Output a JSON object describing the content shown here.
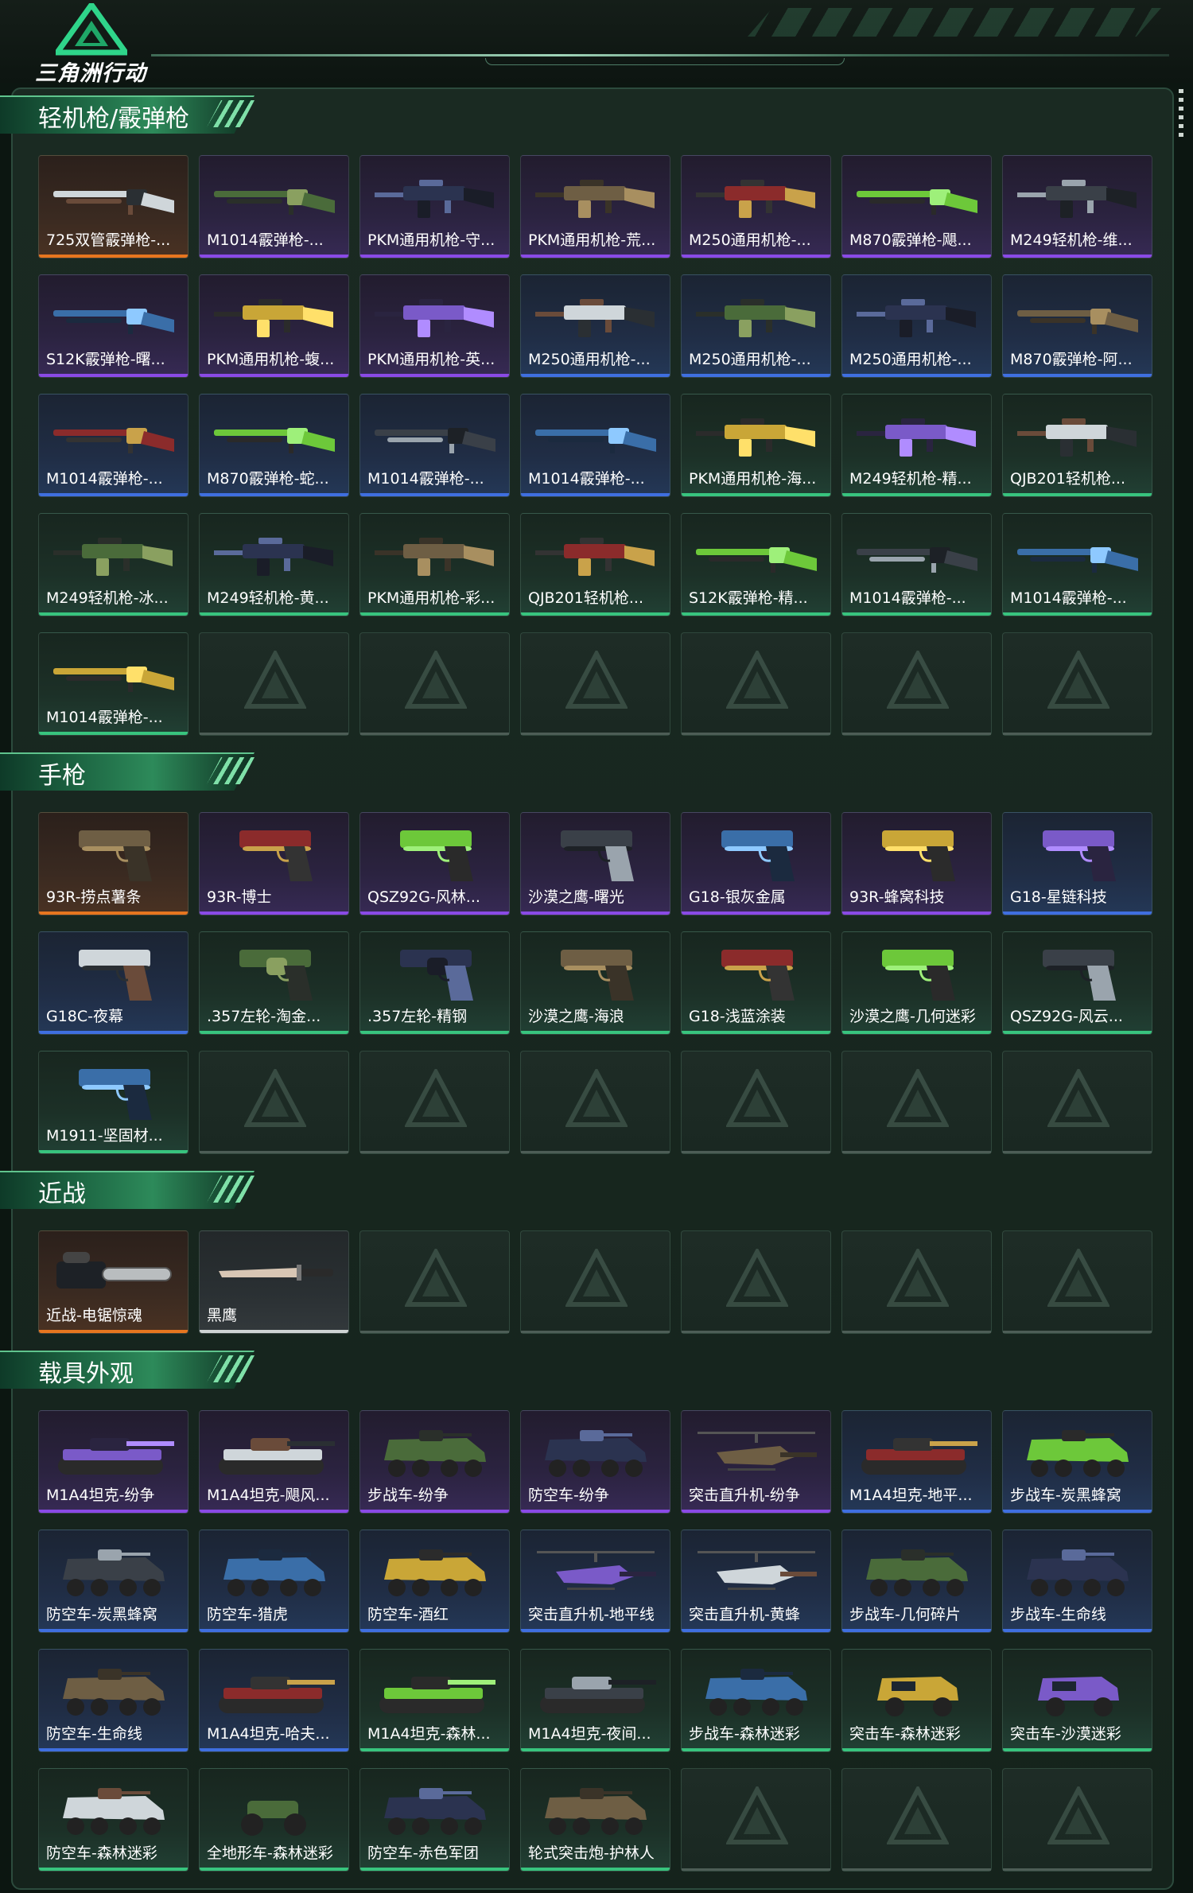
{
  "header": {
    "logo_text": "三角洲行动"
  },
  "colors": {
    "orange": "#e7761f",
    "purple": "#8a4ae6",
    "blue": "#3f6fe0",
    "green": "#38c47e",
    "white": "#cfd4d4"
  },
  "sections": [
    {
      "title": "轻机枪/霰弹枪",
      "slots": 35,
      "items": [
        {
          "name": "725双管霰弹枪-...",
          "rarity": "orange",
          "icon": "shotgun-icon"
        },
        {
          "name": "M1014霰弹枪-...",
          "rarity": "purple",
          "icon": "shotgun-icon"
        },
        {
          "name": "PKM通用机枪-守...",
          "rarity": "purple",
          "icon": "machinegun-icon"
        },
        {
          "name": "PKM通用机枪-荒...",
          "rarity": "purple",
          "icon": "machinegun-icon"
        },
        {
          "name": "M250通用机枪-...",
          "rarity": "purple",
          "icon": "machinegun-icon"
        },
        {
          "name": "M870霰弹枪-飓...",
          "rarity": "purple",
          "icon": "shotgun-icon"
        },
        {
          "name": "M249轻机枪-维...",
          "rarity": "purple",
          "icon": "machinegun-icon"
        },
        {
          "name": "S12K霰弹枪-曙...",
          "rarity": "purple",
          "icon": "shotgun-icon"
        },
        {
          "name": "PKM通用机枪-蝮...",
          "rarity": "purple",
          "icon": "machinegun-icon"
        },
        {
          "name": "PKM通用机枪-英...",
          "rarity": "purple",
          "icon": "machinegun-icon"
        },
        {
          "name": "M250通用机枪-...",
          "rarity": "blue",
          "icon": "machinegun-icon"
        },
        {
          "name": "M250通用机枪-...",
          "rarity": "blue",
          "icon": "machinegun-icon"
        },
        {
          "name": "M250通用机枪-...",
          "rarity": "blue",
          "icon": "machinegun-icon"
        },
        {
          "name": "M870霰弹枪-阿...",
          "rarity": "blue",
          "icon": "shotgun-icon"
        },
        {
          "name": "M1014霰弹枪-...",
          "rarity": "blue",
          "icon": "shotgun-icon"
        },
        {
          "name": "M870霰弹枪-蛇...",
          "rarity": "blue",
          "icon": "shotgun-icon"
        },
        {
          "name": "M1014霰弹枪-...",
          "rarity": "blue",
          "icon": "shotgun-icon"
        },
        {
          "name": "M1014霰弹枪-...",
          "rarity": "blue",
          "icon": "shotgun-icon"
        },
        {
          "name": "PKM通用机枪-海...",
          "rarity": "green",
          "icon": "machinegun-icon"
        },
        {
          "name": "M249轻机枪-精...",
          "rarity": "green",
          "icon": "machinegun-icon"
        },
        {
          "name": "QJB201轻机枪...",
          "rarity": "green",
          "icon": "machinegun-icon"
        },
        {
          "name": "M249轻机枪-冰...",
          "rarity": "green",
          "icon": "machinegun-icon"
        },
        {
          "name": "M249轻机枪-黄...",
          "rarity": "green",
          "icon": "machinegun-icon"
        },
        {
          "name": "PKM通用机枪-彩...",
          "rarity": "green",
          "icon": "machinegun-icon"
        },
        {
          "name": "QJB201轻机枪...",
          "rarity": "green",
          "icon": "machinegun-icon"
        },
        {
          "name": "S12K霰弹枪-精...",
          "rarity": "green",
          "icon": "shotgun-icon"
        },
        {
          "name": "M1014霰弹枪-...",
          "rarity": "green",
          "icon": "shotgun-icon"
        },
        {
          "name": "M1014霰弹枪-...",
          "rarity": "green",
          "icon": "shotgun-icon"
        },
        {
          "name": "M1014霰弹枪-...",
          "rarity": "green",
          "icon": "shotgun-icon"
        }
      ]
    },
    {
      "title": "手枪",
      "slots": 21,
      "items": [
        {
          "name": "93R-捞点薯条",
          "rarity": "orange",
          "icon": "pistol-icon"
        },
        {
          "name": "93R-博士",
          "rarity": "purple",
          "icon": "pistol-icon"
        },
        {
          "name": "QSZ92G-风林...",
          "rarity": "purple",
          "icon": "pistol-icon"
        },
        {
          "name": "沙漠之鹰-曙光",
          "rarity": "purple",
          "icon": "pistol-icon"
        },
        {
          "name": "G18-银灰金属",
          "rarity": "purple",
          "icon": "pistol-icon"
        },
        {
          "name": "93R-蜂窝科技",
          "rarity": "purple",
          "icon": "pistol-icon"
        },
        {
          "name": "G18-星链科技",
          "rarity": "blue",
          "icon": "pistol-icon"
        },
        {
          "name": "G18C-夜幕",
          "rarity": "blue",
          "icon": "pistol-icon"
        },
        {
          "name": ".357左轮-淘金...",
          "rarity": "green",
          "icon": "revolver-icon"
        },
        {
          "name": ".357左轮-精钢",
          "rarity": "green",
          "icon": "revolver-icon"
        },
        {
          "name": "沙漠之鹰-海浪",
          "rarity": "green",
          "icon": "pistol-icon"
        },
        {
          "name": "G18-浅蓝涂装",
          "rarity": "green",
          "icon": "pistol-icon"
        },
        {
          "name": "沙漠之鹰-几何迷彩",
          "rarity": "green",
          "icon": "pistol-icon"
        },
        {
          "name": "QSZ92G-风云...",
          "rarity": "green",
          "icon": "pistol-icon"
        },
        {
          "name": "M1911-坚固材...",
          "rarity": "green",
          "icon": "pistol-icon"
        }
      ]
    },
    {
      "title": "近战",
      "slots": 7,
      "items": [
        {
          "name": "近战-电锯惊魂",
          "rarity": "orange",
          "icon": "chainsaw-icon"
        },
        {
          "name": "黑鹰",
          "rarity": "white",
          "icon": "knife-icon"
        }
      ]
    },
    {
      "title": "载具外观",
      "slots": 28,
      "items": [
        {
          "name": "M1A4坦克-纷争",
          "rarity": "purple",
          "icon": "tank-icon"
        },
        {
          "name": "M1A4坦克-飓风...",
          "rarity": "purple",
          "icon": "tank-icon"
        },
        {
          "name": "步战车-纷争",
          "rarity": "purple",
          "icon": "apc-icon"
        },
        {
          "name": "防空车-纷争",
          "rarity": "purple",
          "icon": "apc-icon"
        },
        {
          "name": "突击直升机-纷争",
          "rarity": "purple",
          "icon": "helicopter-icon"
        },
        {
          "name": "M1A4坦克-地平...",
          "rarity": "blue",
          "icon": "tank-icon"
        },
        {
          "name": "步战车-炭黑蜂窝",
          "rarity": "blue",
          "icon": "apc-icon"
        },
        {
          "name": "防空车-炭黑蜂窝",
          "rarity": "blue",
          "icon": "apc-icon"
        },
        {
          "name": "防空车-猎虎",
          "rarity": "blue",
          "icon": "apc-icon"
        },
        {
          "name": "防空车-酒红",
          "rarity": "blue",
          "icon": "apc-icon"
        },
        {
          "name": "突击直升机-地平线",
          "rarity": "blue",
          "icon": "helicopter-icon"
        },
        {
          "name": "突击直升机-黄蜂",
          "rarity": "blue",
          "icon": "helicopter-icon"
        },
        {
          "name": "步战车-几何碎片",
          "rarity": "blue",
          "icon": "apc-icon"
        },
        {
          "name": "步战车-生命线",
          "rarity": "blue",
          "icon": "apc-icon"
        },
        {
          "name": "防空车-生命线",
          "rarity": "blue",
          "icon": "apc-icon"
        },
        {
          "name": "M1A4坦克-哈夫...",
          "rarity": "blue",
          "icon": "tank-icon"
        },
        {
          "name": "M1A4坦克-森林...",
          "rarity": "green",
          "icon": "tank-icon"
        },
        {
          "name": "M1A4坦克-夜间...",
          "rarity": "green",
          "icon": "tank-icon"
        },
        {
          "name": "步战车-森林迷彩",
          "rarity": "green",
          "icon": "apc-icon"
        },
        {
          "name": "突击车-森林迷彩",
          "rarity": "green",
          "icon": "jeep-icon"
        },
        {
          "name": "突击车-沙漠迷彩",
          "rarity": "green",
          "icon": "jeep-icon"
        },
        {
          "name": "防空车-森林迷彩",
          "rarity": "green",
          "icon": "apc-icon"
        },
        {
          "name": "全地形车-森林迷彩",
          "rarity": "green",
          "icon": "atv-icon"
        },
        {
          "name": "防空车-赤色军团",
          "rarity": "green",
          "icon": "apc-icon"
        },
        {
          "name": "轮式突击炮-护林人",
          "rarity": "green",
          "icon": "apc-icon"
        }
      ]
    }
  ]
}
